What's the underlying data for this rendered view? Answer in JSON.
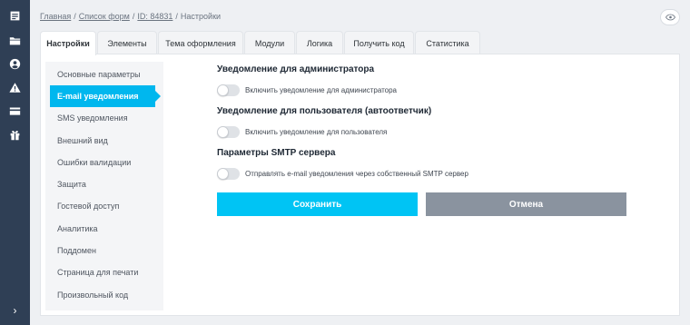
{
  "breadcrumb": {
    "items": [
      "Главная",
      "Список форм",
      "ID: 84831"
    ],
    "current": "Настройки",
    "separator": "/"
  },
  "tabs": [
    {
      "label": "Настройки",
      "active": true
    },
    {
      "label": "Элементы"
    },
    {
      "label": "Тема оформления"
    },
    {
      "label": "Модули"
    },
    {
      "label": "Логика"
    },
    {
      "label": "Получить код"
    },
    {
      "label": "Статистика"
    }
  ],
  "subnav": {
    "items": [
      {
        "label": "Основные параметры"
      },
      {
        "label": "E-mail уведомления",
        "active": true
      },
      {
        "label": "SMS уведомления"
      },
      {
        "label": "Внешний вид"
      },
      {
        "label": "Ошибки валидации"
      },
      {
        "label": "Защита"
      },
      {
        "label": "Гостевой доступ"
      },
      {
        "label": "Аналитика"
      },
      {
        "label": "Поддомен"
      },
      {
        "label": "Страница для печати"
      },
      {
        "label": "Произвольный код"
      }
    ]
  },
  "sections": [
    {
      "title": "Уведомление для администратора",
      "toggle_label": "Включить уведомление для администратора",
      "enabled": false
    },
    {
      "title": "Уведомление для пользователя (автоответчик)",
      "toggle_label": "Включить уведомление для пользователя",
      "enabled": false
    },
    {
      "title": "Параметры SMTP сервера",
      "toggle_label": "Отправлять e-mail уведомления через собственный SMTP сервер",
      "enabled": false
    }
  ],
  "actions": {
    "save_label": "Сохранить",
    "cancel_label": "Отмена"
  },
  "rail": {
    "icons": [
      "forms-icon",
      "folder-icon",
      "account-icon",
      "warning-icon",
      "billing-card-icon",
      "gift-icon"
    ],
    "expand_glyph": "›"
  },
  "colors": {
    "accent": "#00c4f4",
    "active_nav": "#00b7ee",
    "sidebar": "#2f3f55",
    "cancel": "#8a939f"
  }
}
